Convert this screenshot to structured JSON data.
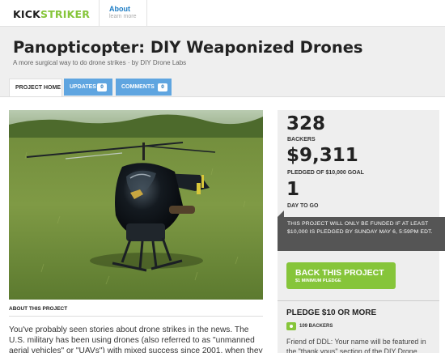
{
  "topbar": {
    "logo_part1": "KICK",
    "logo_part2": "STRIKER",
    "nav_about": "About",
    "nav_about_sub": "learn more"
  },
  "project": {
    "title": "Panopticopter: DIY Weaponized Drones",
    "subtitle": "A more surgical way to do drone strikes · by DIY Drone Labs"
  },
  "tabs": [
    {
      "label": "PROJECT HOME"
    },
    {
      "label": "UPDATES",
      "count": "0"
    },
    {
      "label": "COMMENTS",
      "count": "0"
    }
  ],
  "about": {
    "label": "ABOUT THIS PROJECT",
    "text": "You've probably seen stories about drone strikes in the news. The U.S. military has been using drones (also referred to as \"unmanned aerial vehicles\" or \"UAVs\") with mixed success since 2001, when they"
  },
  "stats": {
    "backers": "328",
    "backers_label": "BACKERS",
    "pledged": "$9,311",
    "pledged_label": "PLEDGED OF $10,000 GOAL",
    "days": "1",
    "days_label": "DAY TO GO"
  },
  "notice": "THIS PROJECT WILL ONLY BE FUNDED IF AT LEAST $10,000 IS PLEDGED BY SUNDAY MAY 6, 5:59PM EDT.",
  "back_button": {
    "label": "BACK THIS PROJECT",
    "sub": "$1 MINIMUM PLEDGE"
  },
  "reward": {
    "title": "PLEDGE $10 OR MORE",
    "backers": "109 BACKERS",
    "description": "Friend of DDL: Your name will be featured in the \"thank yous\" section of the DIY Drone"
  },
  "colors": {
    "brand_green": "#86c53a",
    "tab_blue": "#5fa5e0",
    "link_blue": "#1a7bc4"
  }
}
